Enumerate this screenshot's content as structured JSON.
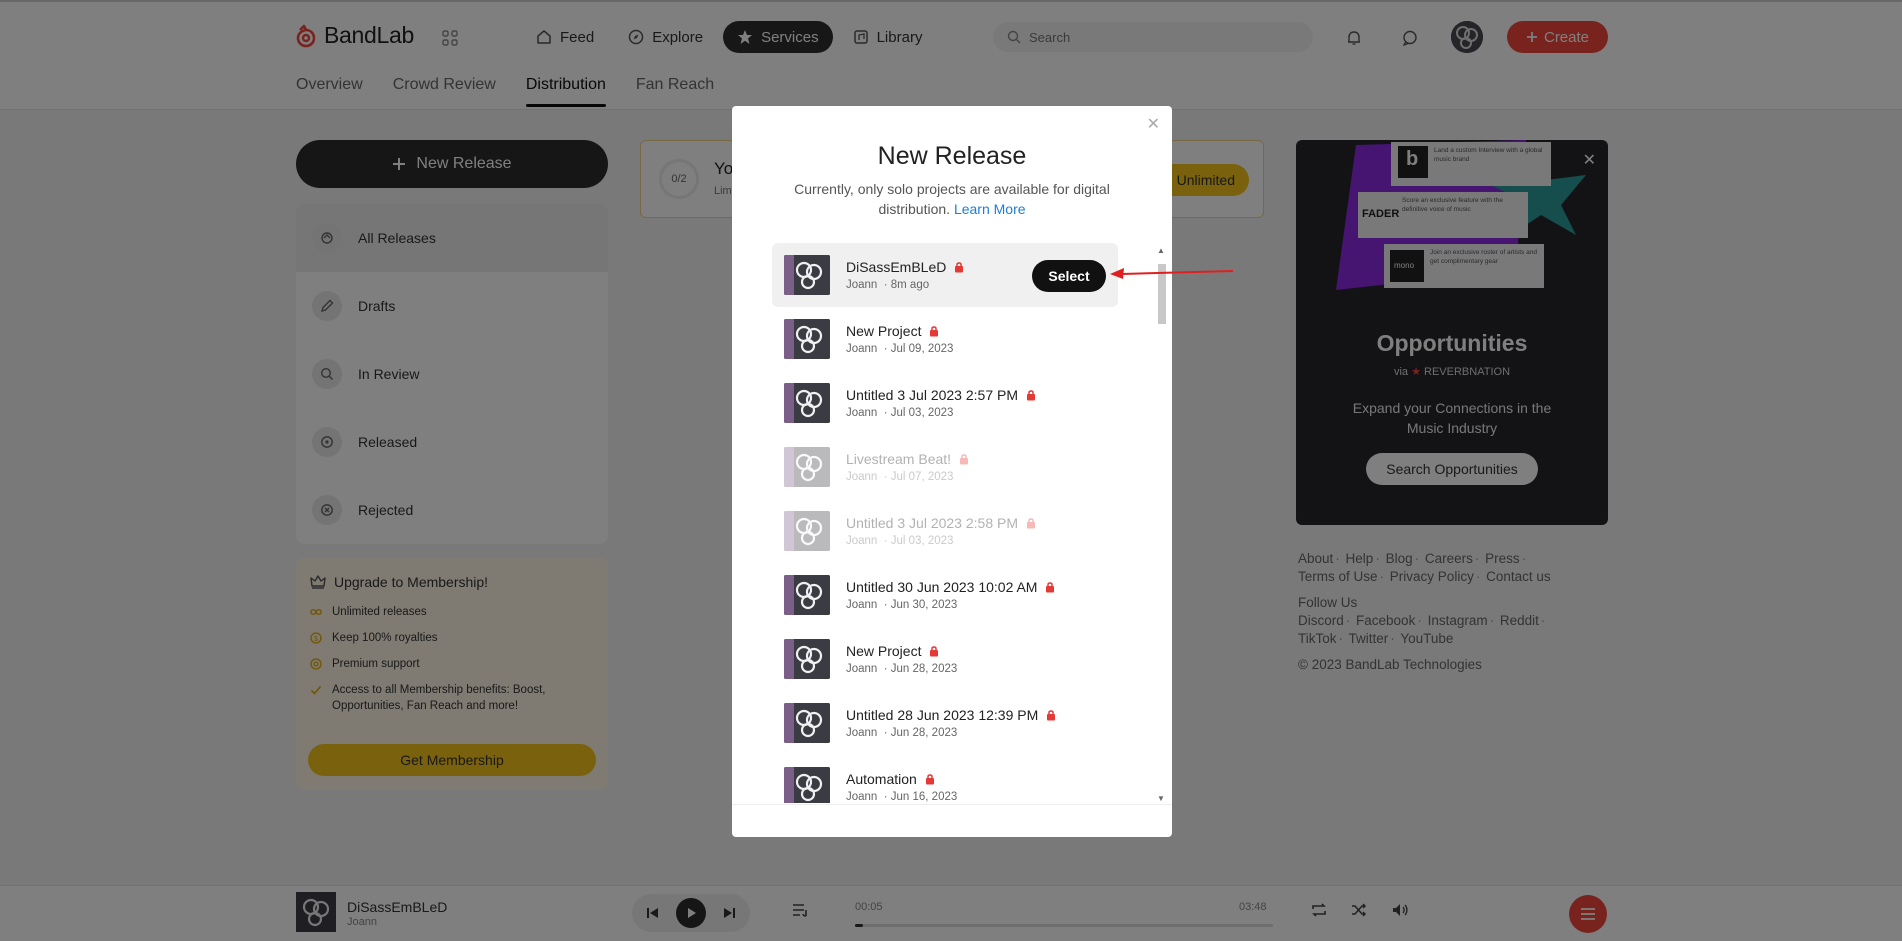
{
  "header": {
    "brand": "BandLab",
    "nav": [
      {
        "label": "Feed",
        "icon": "home-icon"
      },
      {
        "label": "Explore",
        "icon": "compass-icon"
      },
      {
        "label": "Services",
        "icon": "star-icon",
        "active": true
      },
      {
        "label": "Library",
        "icon": "library-icon"
      }
    ],
    "search_placeholder": "Search",
    "create_label": "Create",
    "accent": "#f2473f"
  },
  "subnav": [
    "Overview",
    "Crowd Review",
    "Distribution",
    "Fan Reach"
  ],
  "sidebar": {
    "new_release_label": "New Release",
    "items": [
      {
        "label": "All Releases",
        "icon": "all-releases-icon"
      },
      {
        "label": "Drafts",
        "icon": "pencil-icon"
      },
      {
        "label": "In Review",
        "icon": "magnifier-icon"
      },
      {
        "label": "Released",
        "icon": "released-icon"
      },
      {
        "label": "Rejected",
        "icon": "rejected-icon"
      }
    ]
  },
  "upgrade": {
    "title": "Upgrade to Membership!",
    "benefits": [
      "Unlimited releases",
      "Keep 100% royalties",
      "Premium support",
      "Access to all Membership benefits: Boost, Opportunities, Fan Reach and more!"
    ],
    "button": "Get Membership"
  },
  "release_card": {
    "count": "0/2",
    "title_prefix": "Yo",
    "sub_prefix": "Lim",
    "pill": "Unlimited"
  },
  "opportunities": {
    "title": "Opportunities",
    "via": "via",
    "partner": "REVERBNATION",
    "description": "Expand your Connections in the Music Industry",
    "button": "Search Opportunities",
    "promo_1": "Land a custom Interview with a global music brand",
    "promo_2": "Score an exclusive feature with the definitive voice of music",
    "promo_3": "Join an exclusive roster of artists and get complimentary gear",
    "promo_brand_2": "FADER",
    "promo_brand_3": "mono",
    "promo_brand_1": "b"
  },
  "footer": {
    "links_1": [
      "About",
      "Help",
      "Blog",
      "Careers",
      "Press"
    ],
    "links_2": [
      "Terms of Use",
      "Privacy Policy",
      "Contact us"
    ],
    "follow": "Follow Us",
    "social_1": [
      "Discord",
      "Facebook",
      "Instagram",
      "Reddit"
    ],
    "social_2": [
      "TikTok",
      "Twitter",
      "YouTube"
    ],
    "copyright": "© 2023 BandLab Technologies"
  },
  "player": {
    "title": "DiSassEmBLeD",
    "artist": "Joann",
    "current_time": "00:05",
    "total_time": "03:48",
    "progress": 0.02
  },
  "modal": {
    "title": "New Release",
    "description": "Currently, only solo projects are available for digital distribution.",
    "link": "Learn More",
    "select_label": "Select",
    "projects": [
      {
        "name": "DiSassEmBLeD",
        "author": "Joann",
        "time": "· 8m ago",
        "state": "hover"
      },
      {
        "name": "New Project",
        "author": "Joann",
        "time": "· Jul 09, 2023",
        "state": "normal"
      },
      {
        "name": "Untitled 3 Jul 2023 2:57 PM",
        "author": "Joann",
        "time": "· Jul 03, 2023",
        "state": "normal"
      },
      {
        "name": "Livestream Beat!",
        "author": "Joann",
        "time": "· Jul 07, 2023",
        "state": "disabled"
      },
      {
        "name": "Untitled 3 Jul 2023 2:58 PM",
        "author": "Joann",
        "time": "· Jul 03, 2023",
        "state": "disabled"
      },
      {
        "name": "Untitled 30 Jun 2023 10:02 AM",
        "author": "Joann",
        "time": "· Jun 30, 2023",
        "state": "normal"
      },
      {
        "name": "New Project",
        "author": "Joann",
        "time": "· Jun 28, 2023",
        "state": "normal"
      },
      {
        "name": "Untitled 28 Jun 2023 12:39 PM",
        "author": "Joann",
        "time": "· Jun 28, 2023",
        "state": "normal"
      },
      {
        "name": "Automation",
        "author": "Joann",
        "time": "· Jun 16, 2023",
        "state": "normal"
      }
    ]
  }
}
